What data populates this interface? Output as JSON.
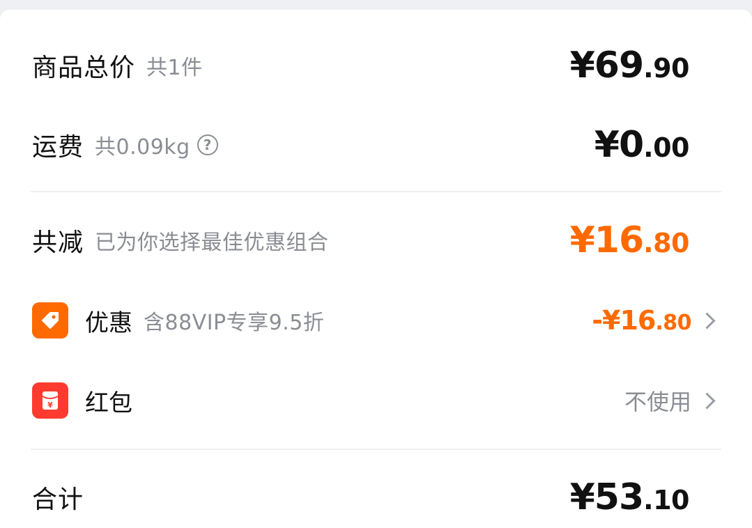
{
  "goods_total": {
    "label": "商品总价",
    "sub": "共1件",
    "currency": "¥",
    "int": "69",
    "dec": ".90"
  },
  "shipping": {
    "label": "运费",
    "sub": "共0.09kg",
    "help_glyph": "?",
    "currency": "¥",
    "int": "0",
    "dec": ".00"
  },
  "discount_total": {
    "label": "共减",
    "sub": "已为你选择最佳优惠组合",
    "currency": "¥",
    "int": "16",
    "dec": ".80"
  },
  "promo": {
    "icon": "tag-icon",
    "label": "优惠",
    "sub": "含88VIP专享9.5折",
    "prefix": "-¥",
    "int": "16",
    "dec": ".80"
  },
  "red_packet": {
    "icon": "red-packet-icon",
    "label": "红包",
    "value": "不使用"
  },
  "total": {
    "label": "合计",
    "currency": "¥",
    "int": "53",
    "dec": ".10"
  },
  "colors": {
    "accent": "#ff6a00",
    "red_packet": "#ff3b30",
    "text": "#111111",
    "muted": "#8a8d93"
  }
}
